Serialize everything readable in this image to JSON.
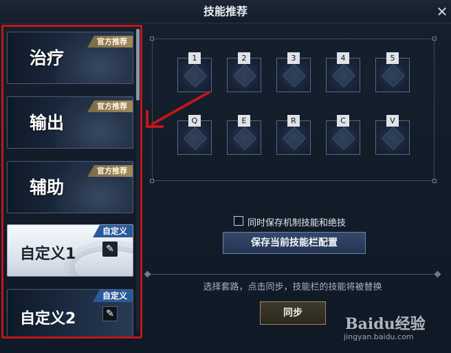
{
  "window": {
    "title": "技能推荐",
    "close_glyph": "✕"
  },
  "list": {
    "items": [
      {
        "name": "治疗",
        "tag": "官方推荐"
      },
      {
        "name": "输出",
        "tag": "官方推荐"
      },
      {
        "name": "辅助",
        "tag": "官方推荐"
      },
      {
        "name": "自定义1",
        "tag": "自定义",
        "selected": true
      },
      {
        "name": "自定义2",
        "tag": "自定义"
      }
    ]
  },
  "skillbar": {
    "row1_keys": [
      "1",
      "2",
      "3",
      "4",
      "5"
    ],
    "row2_keys": [
      "Q",
      "E",
      "R",
      "C",
      "V"
    ]
  },
  "controls": {
    "checkbox_label": "同时保存机制技能和绝技",
    "checkbox_checked": false,
    "save_button": "保存当前技能栏配置",
    "hint": "选择套路，点击同步，技能栏的技能将被替换",
    "sync_button": "同步"
  },
  "watermark": {
    "logo": "Baidu经验",
    "sub": "jingyan.baidu.com"
  },
  "colors": {
    "highlight_box": "#c0161a",
    "official_tag": "#a08a58",
    "custom_tag": "#2b5a9a"
  }
}
